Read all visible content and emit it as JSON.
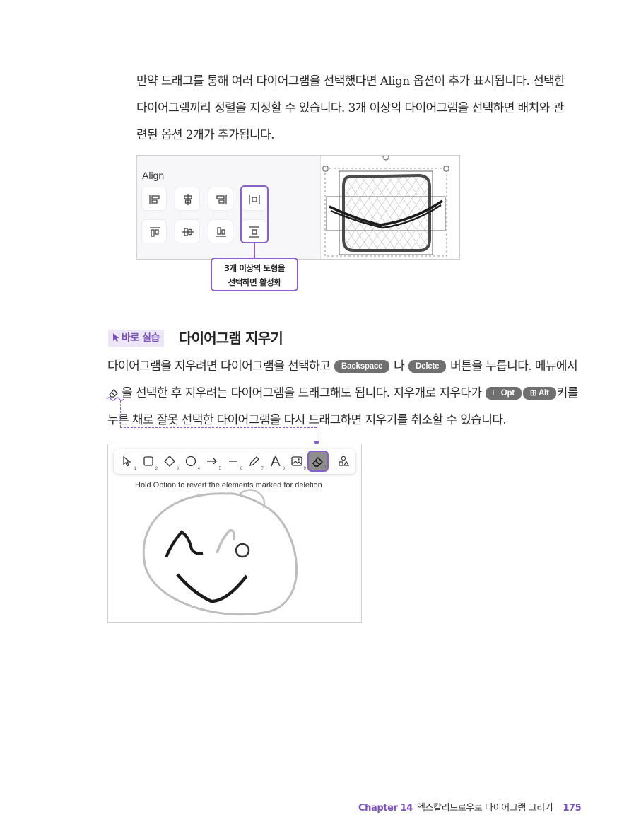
{
  "intro": {
    "lines": [
      "만약 드래그를 통해 여러 다이어그램을 선택했다면 Align 옵션이 추가 표시됩니다. 선택한",
      "다이어그램끼리 정렬을 지정할 수 있습니다. 3개 이상의 다이어그램을 선택하면 배치와 관",
      "련된 옵션 2개가 추가됩니다."
    ]
  },
  "figure1": {
    "align_label": "Align",
    "callout_lines": [
      "3개 이상의 도형을",
      "선택하면 활성화"
    ]
  },
  "section": {
    "badge": "바로 실습",
    "title": "다이어그램 지우기"
  },
  "body": {
    "l1_a": "다이어그램을 지우려면 다이어그램을 선택하고",
    "key_backspace": "Backspace",
    "l1_b": "나",
    "key_delete": "Delete",
    "l1_c": "버튼을 누릅니다. 메뉴에서",
    "l2_a": "을 선택한 후 지우려는 다이어그램을 드래그해도 됩니다. 지우개로 지우다가",
    "key_opt": "Opt",
    "key_alt": "Alt",
    "l2_b": "키를",
    "l3": "누른 채로 잘못 선택한 다이어그램을 다시 드래그하면 지우기를 취소할 수 있습니다."
  },
  "figure2": {
    "hint": "Hold Option to revert the elements marked for deletion",
    "tools": [
      {
        "icon": "selection-arrow-icon",
        "num": "1"
      },
      {
        "icon": "rectangle-icon",
        "num": "2"
      },
      {
        "icon": "diamond-icon",
        "num": "3"
      },
      {
        "icon": "ellipse-icon",
        "num": "4"
      },
      {
        "icon": "arrow-icon",
        "num": "5"
      },
      {
        "icon": "line-icon",
        "num": "6"
      },
      {
        "icon": "pencil-icon",
        "num": "7"
      },
      {
        "icon": "text-icon",
        "num": "8"
      },
      {
        "icon": "image-icon",
        "num": "9"
      },
      {
        "icon": "eraser-icon",
        "num": "0"
      },
      {
        "icon": "shapes-library-icon",
        "num": ""
      }
    ],
    "active_tool": "eraser-icon"
  },
  "footer": {
    "chapter": "Chapter 14",
    "title": "엑스칼리드로우로 다이어그램 그리기",
    "page": "175"
  },
  "colors": {
    "accent": "#8a60c8",
    "badge_bg": "#ece6f6",
    "key_bg": "#6f6f6f"
  }
}
